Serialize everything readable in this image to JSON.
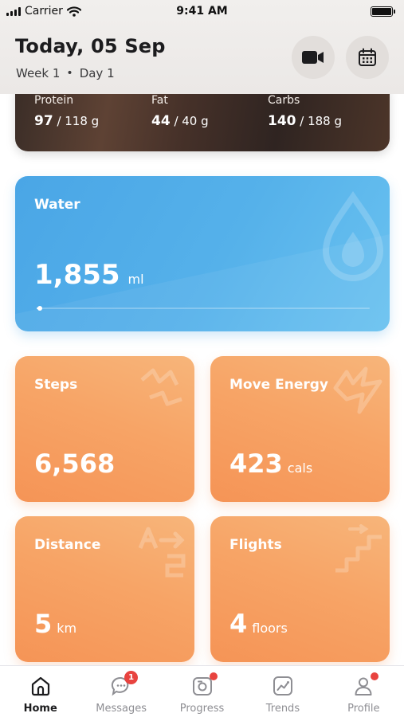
{
  "status_bar": {
    "carrier": "Carrier",
    "time": "9:41 AM"
  },
  "header": {
    "title": "Today, 05 Sep",
    "week": "Week 1",
    "separator": "•",
    "day": "Day 1",
    "video_icon": "video-camera-icon",
    "calendar_icon": "calendar-icon"
  },
  "macros": [
    {
      "label": "Protein",
      "value": "97",
      "target": " / 118 g"
    },
    {
      "label": "Fat",
      "value": "44",
      "target": " / 40 g"
    },
    {
      "label": "Carbs",
      "value": "140",
      "target": " / 188 g"
    }
  ],
  "water": {
    "title": "Water",
    "value": "1,855",
    "unit": "ml",
    "progress": 0.01,
    "icon": "water-drop-icon"
  },
  "tiles": [
    {
      "title": "Steps",
      "value": "6,568",
      "unit": "",
      "icon": "steps-icon"
    },
    {
      "title": "Move Energy",
      "value": "423",
      "unit": "cals",
      "icon": "energy-icon"
    },
    {
      "title": "Distance",
      "value": "5",
      "unit": "km",
      "icon": "distance-icon"
    },
    {
      "title": "Flights",
      "value": "4",
      "unit": "floors",
      "icon": "stairs-icon"
    }
  ],
  "tab_bar": [
    {
      "label": "Home",
      "icon": "home-icon",
      "active": true
    },
    {
      "label": "Messages",
      "icon": "chat-icon",
      "badge": "1"
    },
    {
      "label": "Progress",
      "icon": "camera-icon",
      "dot": true
    },
    {
      "label": "Trends",
      "icon": "trend-icon"
    },
    {
      "label": "Profile",
      "icon": "profile-icon",
      "dot": true
    }
  ],
  "colors": {
    "water_blue": "#55b1ea",
    "tile_orange": "#f7a466",
    "badge_red": "#e8433f",
    "header_bg": "#efecea"
  }
}
